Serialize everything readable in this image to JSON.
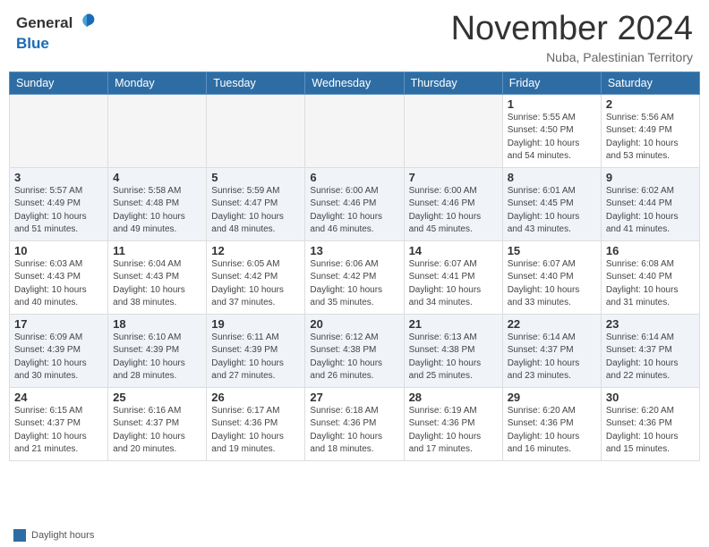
{
  "header": {
    "logo_general": "General",
    "logo_blue": "Blue",
    "month_title": "November 2024",
    "location": "Nuba, Palestinian Territory"
  },
  "calendar": {
    "weekdays": [
      "Sunday",
      "Monday",
      "Tuesday",
      "Wednesday",
      "Thursday",
      "Friday",
      "Saturday"
    ],
    "weeks": [
      [
        {
          "day": "",
          "info": ""
        },
        {
          "day": "",
          "info": ""
        },
        {
          "day": "",
          "info": ""
        },
        {
          "day": "",
          "info": ""
        },
        {
          "day": "",
          "info": ""
        },
        {
          "day": "1",
          "info": "Sunrise: 5:55 AM\nSunset: 4:50 PM\nDaylight: 10 hours\nand 54 minutes."
        },
        {
          "day": "2",
          "info": "Sunrise: 5:56 AM\nSunset: 4:49 PM\nDaylight: 10 hours\nand 53 minutes."
        }
      ],
      [
        {
          "day": "3",
          "info": "Sunrise: 5:57 AM\nSunset: 4:49 PM\nDaylight: 10 hours\nand 51 minutes."
        },
        {
          "day": "4",
          "info": "Sunrise: 5:58 AM\nSunset: 4:48 PM\nDaylight: 10 hours\nand 49 minutes."
        },
        {
          "day": "5",
          "info": "Sunrise: 5:59 AM\nSunset: 4:47 PM\nDaylight: 10 hours\nand 48 minutes."
        },
        {
          "day": "6",
          "info": "Sunrise: 6:00 AM\nSunset: 4:46 PM\nDaylight: 10 hours\nand 46 minutes."
        },
        {
          "day": "7",
          "info": "Sunrise: 6:00 AM\nSunset: 4:46 PM\nDaylight: 10 hours\nand 45 minutes."
        },
        {
          "day": "8",
          "info": "Sunrise: 6:01 AM\nSunset: 4:45 PM\nDaylight: 10 hours\nand 43 minutes."
        },
        {
          "day": "9",
          "info": "Sunrise: 6:02 AM\nSunset: 4:44 PM\nDaylight: 10 hours\nand 41 minutes."
        }
      ],
      [
        {
          "day": "10",
          "info": "Sunrise: 6:03 AM\nSunset: 4:43 PM\nDaylight: 10 hours\nand 40 minutes."
        },
        {
          "day": "11",
          "info": "Sunrise: 6:04 AM\nSunset: 4:43 PM\nDaylight: 10 hours\nand 38 minutes."
        },
        {
          "day": "12",
          "info": "Sunrise: 6:05 AM\nSunset: 4:42 PM\nDaylight: 10 hours\nand 37 minutes."
        },
        {
          "day": "13",
          "info": "Sunrise: 6:06 AM\nSunset: 4:42 PM\nDaylight: 10 hours\nand 35 minutes."
        },
        {
          "day": "14",
          "info": "Sunrise: 6:07 AM\nSunset: 4:41 PM\nDaylight: 10 hours\nand 34 minutes."
        },
        {
          "day": "15",
          "info": "Sunrise: 6:07 AM\nSunset: 4:40 PM\nDaylight: 10 hours\nand 33 minutes."
        },
        {
          "day": "16",
          "info": "Sunrise: 6:08 AM\nSunset: 4:40 PM\nDaylight: 10 hours\nand 31 minutes."
        }
      ],
      [
        {
          "day": "17",
          "info": "Sunrise: 6:09 AM\nSunset: 4:39 PM\nDaylight: 10 hours\nand 30 minutes."
        },
        {
          "day": "18",
          "info": "Sunrise: 6:10 AM\nSunset: 4:39 PM\nDaylight: 10 hours\nand 28 minutes."
        },
        {
          "day": "19",
          "info": "Sunrise: 6:11 AM\nSunset: 4:39 PM\nDaylight: 10 hours\nand 27 minutes."
        },
        {
          "day": "20",
          "info": "Sunrise: 6:12 AM\nSunset: 4:38 PM\nDaylight: 10 hours\nand 26 minutes."
        },
        {
          "day": "21",
          "info": "Sunrise: 6:13 AM\nSunset: 4:38 PM\nDaylight: 10 hours\nand 25 minutes."
        },
        {
          "day": "22",
          "info": "Sunrise: 6:14 AM\nSunset: 4:37 PM\nDaylight: 10 hours\nand 23 minutes."
        },
        {
          "day": "23",
          "info": "Sunrise: 6:14 AM\nSunset: 4:37 PM\nDaylight: 10 hours\nand 22 minutes."
        }
      ],
      [
        {
          "day": "24",
          "info": "Sunrise: 6:15 AM\nSunset: 4:37 PM\nDaylight: 10 hours\nand 21 minutes."
        },
        {
          "day": "25",
          "info": "Sunrise: 6:16 AM\nSunset: 4:37 PM\nDaylight: 10 hours\nand 20 minutes."
        },
        {
          "day": "26",
          "info": "Sunrise: 6:17 AM\nSunset: 4:36 PM\nDaylight: 10 hours\nand 19 minutes."
        },
        {
          "day": "27",
          "info": "Sunrise: 6:18 AM\nSunset: 4:36 PM\nDaylight: 10 hours\nand 18 minutes."
        },
        {
          "day": "28",
          "info": "Sunrise: 6:19 AM\nSunset: 4:36 PM\nDaylight: 10 hours\nand 17 minutes."
        },
        {
          "day": "29",
          "info": "Sunrise: 6:20 AM\nSunset: 4:36 PM\nDaylight: 10 hours\nand 16 minutes."
        },
        {
          "day": "30",
          "info": "Sunrise: 6:20 AM\nSunset: 4:36 PM\nDaylight: 10 hours\nand 15 minutes."
        }
      ]
    ]
  },
  "legend": {
    "text": "Daylight hours"
  }
}
